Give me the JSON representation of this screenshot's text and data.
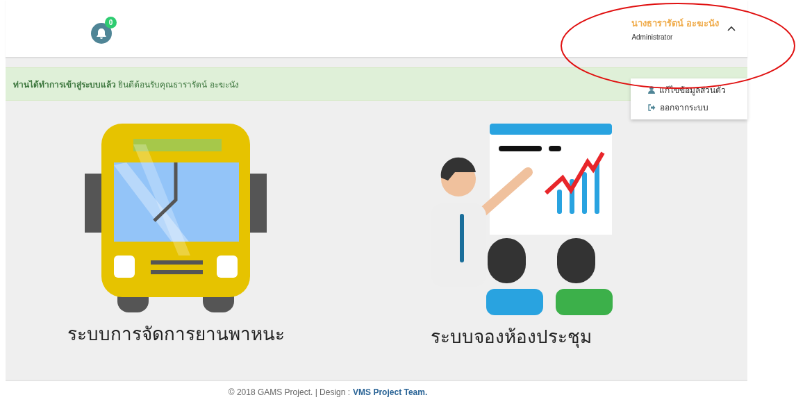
{
  "header": {
    "notification_count": "0",
    "user": {
      "name": "นางธารารัตน์ อะฆะนัง",
      "role": "Administrator",
      "expanded": true
    },
    "menu": [
      {
        "kind": "profile",
        "label": "แก้ไขข้อมูลส่วนตัว"
      },
      {
        "kind": "logout",
        "label": "ออกจากระบบ"
      }
    ]
  },
  "alert": "**ท่านได้ทำการเข้าสู่ระบบแล้ว** ยินดีต้อนรับคุณธารารัตน์ อะฆะนัง",
  "modules": [
    {
      "kind": "vehicle",
      "label": "ระบบการจัดการยานพาหนะ"
    },
    {
      "kind": "meeting",
      "label": "ระบบจองห้องประชุม"
    }
  ],
  "footer": {
    "text": "© 2018 GAMS Project. | Design :",
    "link": "VMS Project Team."
  }
}
